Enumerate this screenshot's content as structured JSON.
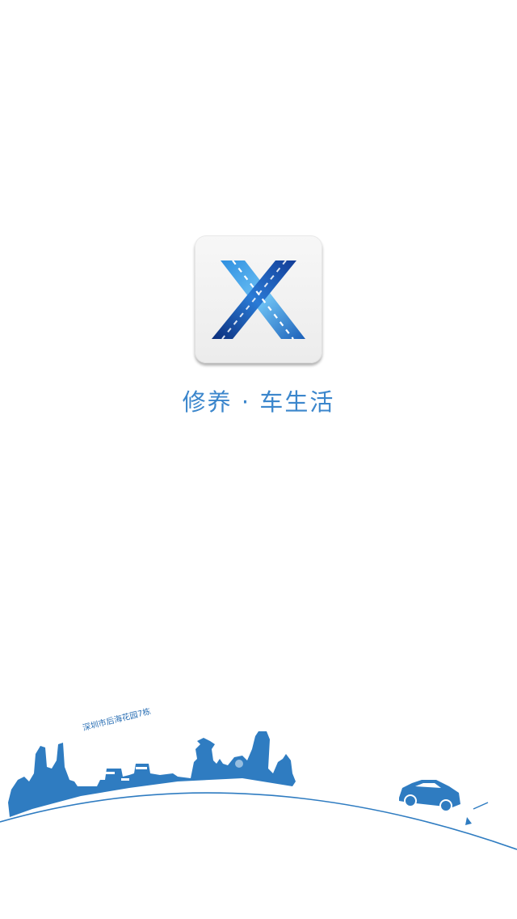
{
  "splash": {
    "logo_icon": "x-road-logo-icon",
    "tagline": "修养 · 车生活",
    "address_label": "深圳市后海花园7栋",
    "illustration_icon": "city-skyline-car-icon"
  },
  "colors": {
    "background": "#ffffff",
    "accent": "#3b86cc",
    "skyline": "#2f7cc1",
    "logo_dark": "#0d2d7a",
    "logo_light": "#39a3ea"
  }
}
